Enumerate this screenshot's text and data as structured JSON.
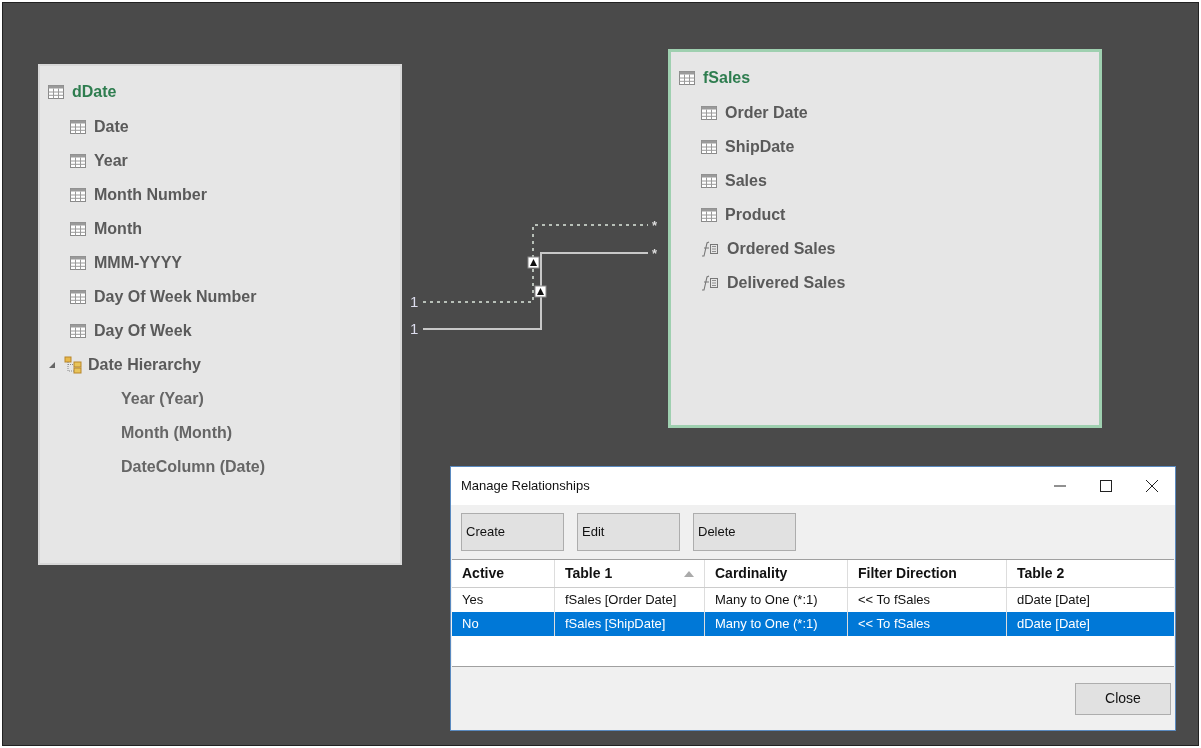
{
  "tables": [
    {
      "name": "dDate",
      "selected": false,
      "fields": [
        {
          "kind": "column",
          "label": "Date"
        },
        {
          "kind": "column",
          "label": "Year"
        },
        {
          "kind": "column",
          "label": "Month Number"
        },
        {
          "kind": "column",
          "label": "Month"
        },
        {
          "kind": "column",
          "label": "MMM-YYYY"
        },
        {
          "kind": "column",
          "label": "Day Of Week Number"
        },
        {
          "kind": "column",
          "label": "Day Of Week"
        },
        {
          "kind": "hierarchy",
          "label": "Date Hierarchy",
          "expanded": true,
          "children": [
            {
              "label": "Year (Year)"
            },
            {
              "label": "Month (Month)"
            },
            {
              "label": "DateColumn (Date)"
            }
          ]
        }
      ]
    },
    {
      "name": "fSales",
      "selected": true,
      "fields": [
        {
          "kind": "column",
          "label": "Order Date"
        },
        {
          "kind": "column",
          "label": "ShipDate"
        },
        {
          "kind": "column",
          "label": "Sales"
        },
        {
          "kind": "column",
          "label": "Product"
        },
        {
          "kind": "measure",
          "label": "Ordered Sales"
        },
        {
          "kind": "measure",
          "label": "Delivered Sales"
        }
      ]
    }
  ],
  "links": [
    {
      "active": false,
      "one_label": "1",
      "many_label": "*"
    },
    {
      "active": true,
      "one_label": "1",
      "many_label": "*"
    }
  ],
  "dialog": {
    "title": "Manage Relationships",
    "buttons": [
      "Create",
      "Edit",
      "Delete"
    ],
    "columns": [
      {
        "label": "Active",
        "sorted": false
      },
      {
        "label": "Table 1",
        "sorted": true
      },
      {
        "label": "Cardinality",
        "sorted": false
      },
      {
        "label": "Filter Direction",
        "sorted": false
      },
      {
        "label": "Table 2",
        "sorted": false
      }
    ],
    "rows": [
      {
        "selected": false,
        "cells": [
          "Yes",
          "fSales [Order Date]",
          "Many to One (*:1)",
          "<< To fSales",
          "dDate [Date]"
        ]
      },
      {
        "selected": true,
        "cells": [
          "No",
          "fSales [ShipDate]",
          "Many to One (*:1)",
          "<< To fSales",
          "dDate [Date]"
        ]
      }
    ],
    "close_button": "Close"
  }
}
